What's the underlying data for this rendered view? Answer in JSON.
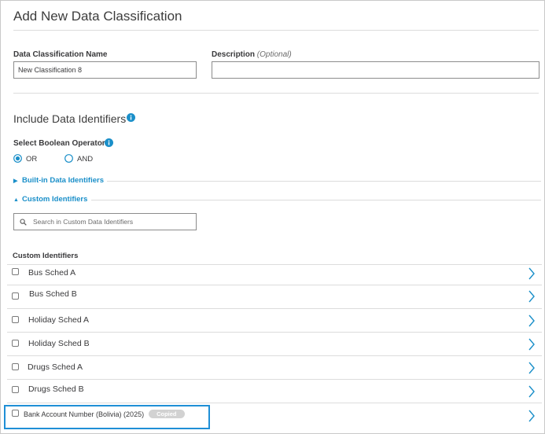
{
  "page": {
    "title": "Add New Data Classification"
  },
  "form": {
    "name_label": "Data Classification Name",
    "name_value": "New Classification 8",
    "description_label": "Description",
    "description_optional": "(Optional)",
    "description_value": ""
  },
  "identifiers": {
    "section_title": "Include Data Identifiers",
    "boolean_label": "Select Boolean Operator",
    "operators": [
      {
        "label": "OR",
        "selected": true
      },
      {
        "label": "AND",
        "selected": false
      }
    ],
    "builtin_label": "Built-in Data Identifiers",
    "custom_label": "Custom Identifiers",
    "search_placeholder": "Search in Custom Data Identifiers",
    "list_header": "Custom Identifiers",
    "items": [
      {
        "label": "Bus Sched A",
        "checked": false
      },
      {
        "label": "Bus Sched B",
        "checked": false
      },
      {
        "label": "Holiday Sched A",
        "checked": false
      },
      {
        "label": "Holiday Sched B",
        "checked": false
      },
      {
        "label": "Drugs Sched A",
        "checked": false
      },
      {
        "label": "Drugs Sched B",
        "checked": false
      },
      {
        "label": "Bank Account Number (Bolivia) (2025)",
        "checked": false,
        "badge": "Copied"
      }
    ]
  },
  "colors": {
    "accent": "#1a8fc9",
    "highlight": "#1f8fd6",
    "badge_bg": "#d2d2d2"
  }
}
